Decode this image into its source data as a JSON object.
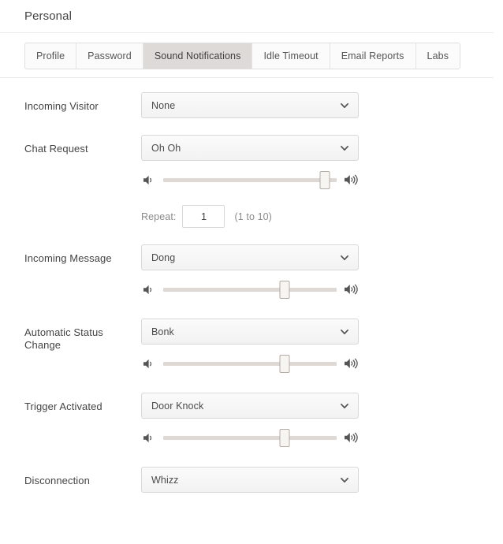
{
  "header": {
    "title": "Personal"
  },
  "tabs": [
    {
      "label": "Profile",
      "active": false,
      "name": "tab-profile"
    },
    {
      "label": "Password",
      "active": false,
      "name": "tab-password"
    },
    {
      "label": "Sound Notifications",
      "active": true,
      "name": "tab-sound-notifications"
    },
    {
      "label": "Idle Timeout",
      "active": false,
      "name": "tab-idle-timeout"
    },
    {
      "label": "Email Reports",
      "active": false,
      "name": "tab-email-reports"
    },
    {
      "label": "Labs",
      "active": false,
      "name": "tab-labs"
    }
  ],
  "icons": {
    "chevron_down": "chevron-down-icon",
    "volume_low": "volume-low-icon",
    "volume_high": "volume-high-icon"
  },
  "colors": {
    "active_tab_bg": "#dedad8",
    "tab_bg": "#fbfbfb",
    "border": "#d8d8d8",
    "divider": "#ebebeb",
    "slider_track": "#ded9d4",
    "slider_handle": "#f7f5f2",
    "label_text": "#444444",
    "muted_text": "#8a8a8a"
  },
  "settings": {
    "incoming_visitor": {
      "label": "Incoming Visitor",
      "sound": "None",
      "has_slider": false
    },
    "chat_request": {
      "label": "Chat Request",
      "sound": "Oh Oh",
      "has_slider": true,
      "volume_percent": 93,
      "repeat": {
        "label": "Repeat:",
        "value": "1",
        "hint": "(1 to 10)"
      }
    },
    "incoming_message": {
      "label": "Incoming Message",
      "sound": "Dong",
      "has_slider": true,
      "volume_percent": 70
    },
    "automatic_status_change": {
      "label": "Automatic Status Change",
      "sound": "Bonk",
      "has_slider": true,
      "volume_percent": 70
    },
    "trigger_activated": {
      "label": "Trigger Activated",
      "sound": "Door Knock",
      "has_slider": true,
      "volume_percent": 70
    },
    "disconnection": {
      "label": "Disconnection",
      "sound": "Whizz",
      "has_slider": false
    }
  }
}
